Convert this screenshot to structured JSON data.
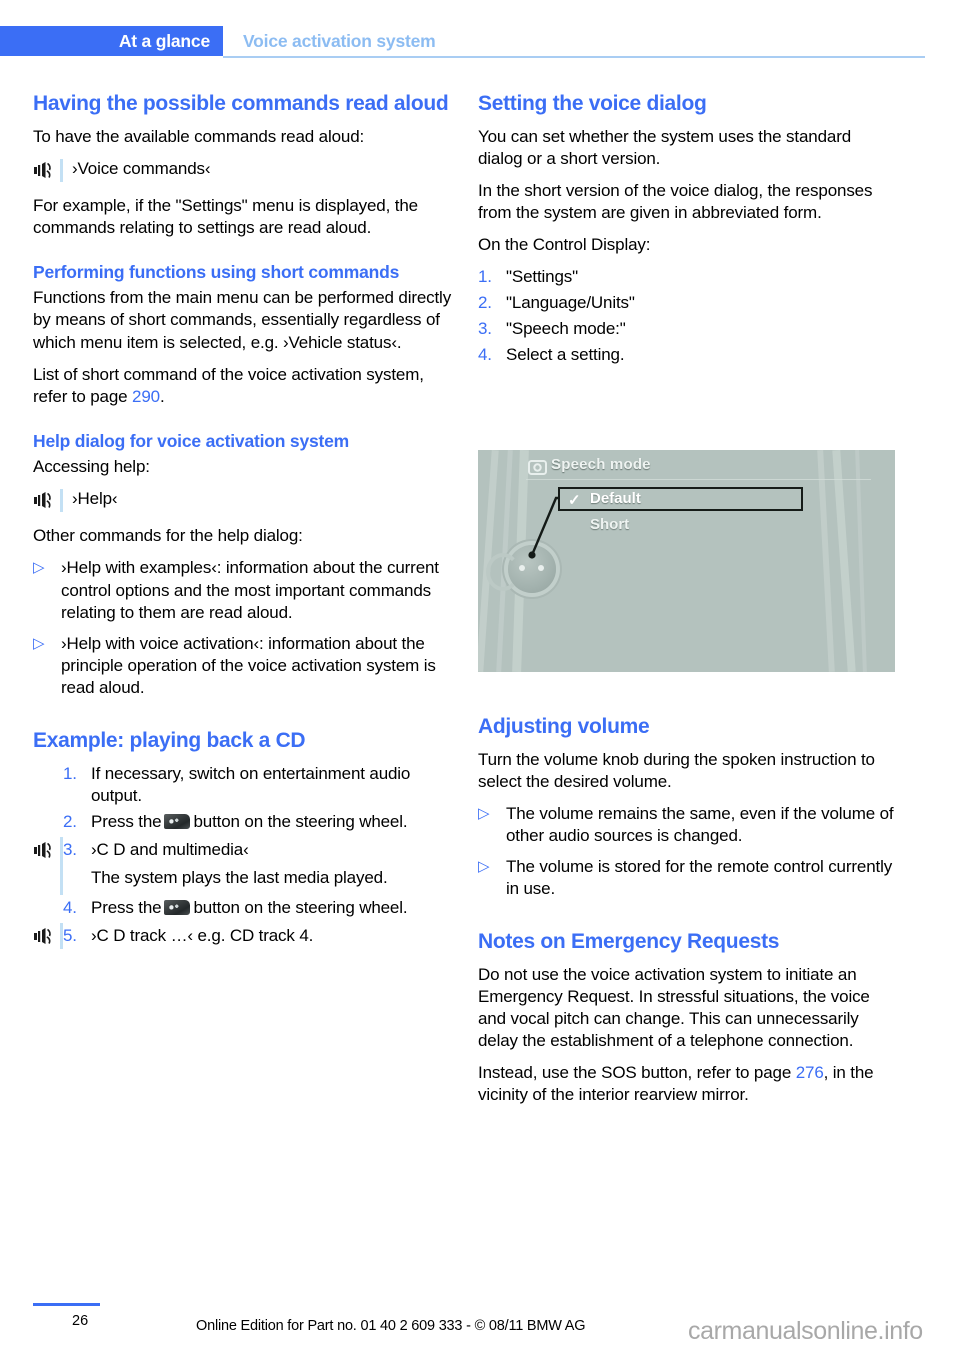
{
  "header": {
    "active_tab": "At a glance",
    "section_title": "Voice activation system",
    "accent_color": "#3b6ef5",
    "muted_color": "#8cbcf2"
  },
  "left_column": {
    "section1": {
      "heading": "Having the possible commands read aloud",
      "intro": "To have the available commands read aloud:",
      "voice_command": "›Voice commands‹",
      "voice_icon": "voice-command-icon",
      "body": "For example, if the \"Settings\" menu is displayed, the commands relating to settings are read aloud."
    },
    "section2": {
      "heading": "Performing functions using short commands",
      "body1_pre": "Functions from the main menu can be performed directly by means of short commands, essentially regardless of which menu item is selected, e.g. ",
      "body1_cmd": "›Vehicle status‹",
      "body1_post": ".",
      "body2_pre": "List of short command of the voice activation system, refer to page ",
      "body2_page": "290",
      "body2_post": "."
    },
    "section3": {
      "heading": "Help dialog for voice activation system",
      "intro": "Accessing help:",
      "voice_command": "›Help‹",
      "voice_icon": "voice-command-icon",
      "other_intro": "Other commands for the help dialog:",
      "bullets": [
        {
          "marker": "▷",
          "command": "›Help with examples‹",
          "text": ": information about the current control options and the most important commands relating to them are read aloud."
        },
        {
          "marker": "▷",
          "command": "›Help with voice activation‹",
          "text": ": information about the principle operation of the voice activation system is read aloud."
        }
      ]
    },
    "section4": {
      "heading": "Example: playing back a CD",
      "steps": [
        {
          "num": "1.",
          "icon": null,
          "text": "If necessary, switch on entertainment audio output."
        },
        {
          "num": "2.",
          "icon": "steering-wheel-button-image",
          "text_before": "Press the",
          "text_after": "button on the steering wheel."
        },
        {
          "num": "3.",
          "icon": "voice-command-icon",
          "text": "›C D and multimedia‹",
          "subtext": "The system plays the last media played."
        },
        {
          "num": "4.",
          "icon": "steering-wheel-button-image",
          "text_before": "Press the",
          "text_after": "button on the steering wheel."
        },
        {
          "num": "5.",
          "icon": "voice-command-icon",
          "text": "›C D track …‹  e.g. CD track 4."
        }
      ]
    }
  },
  "right_column": {
    "section1": {
      "heading": "Setting the voice dialog",
      "body1": "You can set whether the system uses the standard dialog or a short version.",
      "body2": "In the short version of the voice dialog, the responses from the system are given in abbreviated form.",
      "body3": "On the Control Display:",
      "steps": [
        {
          "num": "1.",
          "text": "\"Settings\""
        },
        {
          "num": "2.",
          "text": "\"Language/Units\""
        },
        {
          "num": "3.",
          "text": "\"Speech mode:\""
        },
        {
          "num": "4.",
          "text": "Select a setting."
        }
      ]
    },
    "control_display": {
      "name": "speech-mode-screen",
      "title": "Speech mode",
      "title_icon": "settings-gear-icon",
      "options": [
        {
          "label": "Default",
          "checked": true
        },
        {
          "label": "Short",
          "checked": false
        }
      ],
      "check_glyph": "✓",
      "callout_target": "controller-knob",
      "background_color": "#b4c2be"
    },
    "section2": {
      "heading": "Adjusting volume",
      "body": "Turn the volume knob during the spoken instruction to select the desired volume.",
      "bullets": [
        {
          "marker": "▷",
          "text": "The volume remains the same, even if the volume of other audio sources is changed."
        },
        {
          "marker": "▷",
          "text": "The volume is stored for the remote control currently in use."
        }
      ]
    },
    "section3": {
      "heading": "Notes on Emergency Requests",
      "body1": "Do not use the voice activation system to initiate an Emergency Request. In stressful situations, the voice and vocal pitch can change. This can unnecessarily delay the establishment of a telephone connection.",
      "body2_pre": "Instead, use the SOS button, refer to page ",
      "body2_page": "276",
      "body2_post": ", in the vicinity of the interior rearview mirror."
    }
  },
  "footer": {
    "page_number": "26",
    "note": "Online Edition for Part no. 01 40 2 609 333 - © 08/11 BMW AG",
    "watermark": "carmanualsonline.info"
  }
}
